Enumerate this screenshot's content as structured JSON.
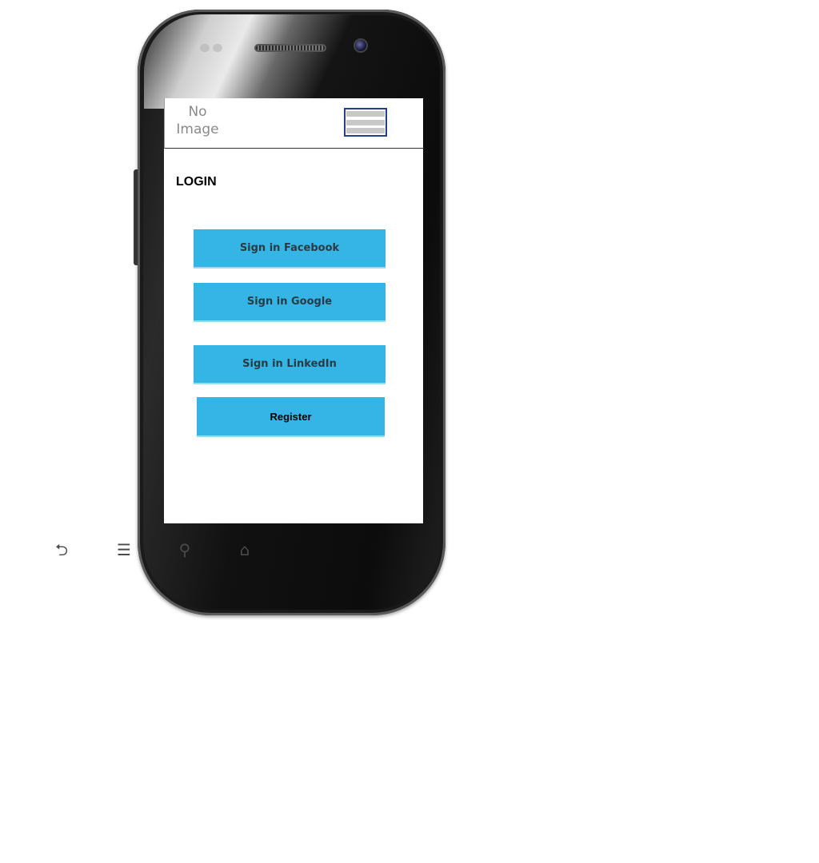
{
  "header": {
    "logo_placeholder": "No Image",
    "menu_icon": "hamburger-menu-icon"
  },
  "page": {
    "title": "LOGIN"
  },
  "buttons": {
    "facebook": "Sign in Facebook",
    "google": "Sign in Google",
    "linkedin": "Sign in LinkedIn",
    "register": "Register"
  },
  "device_nav": {
    "back": "back-icon",
    "menu": "menu-icon",
    "search": "search-icon",
    "home": "home-icon"
  },
  "colors": {
    "button_background": "#35b5e5",
    "menu_border": "#233e8c"
  }
}
